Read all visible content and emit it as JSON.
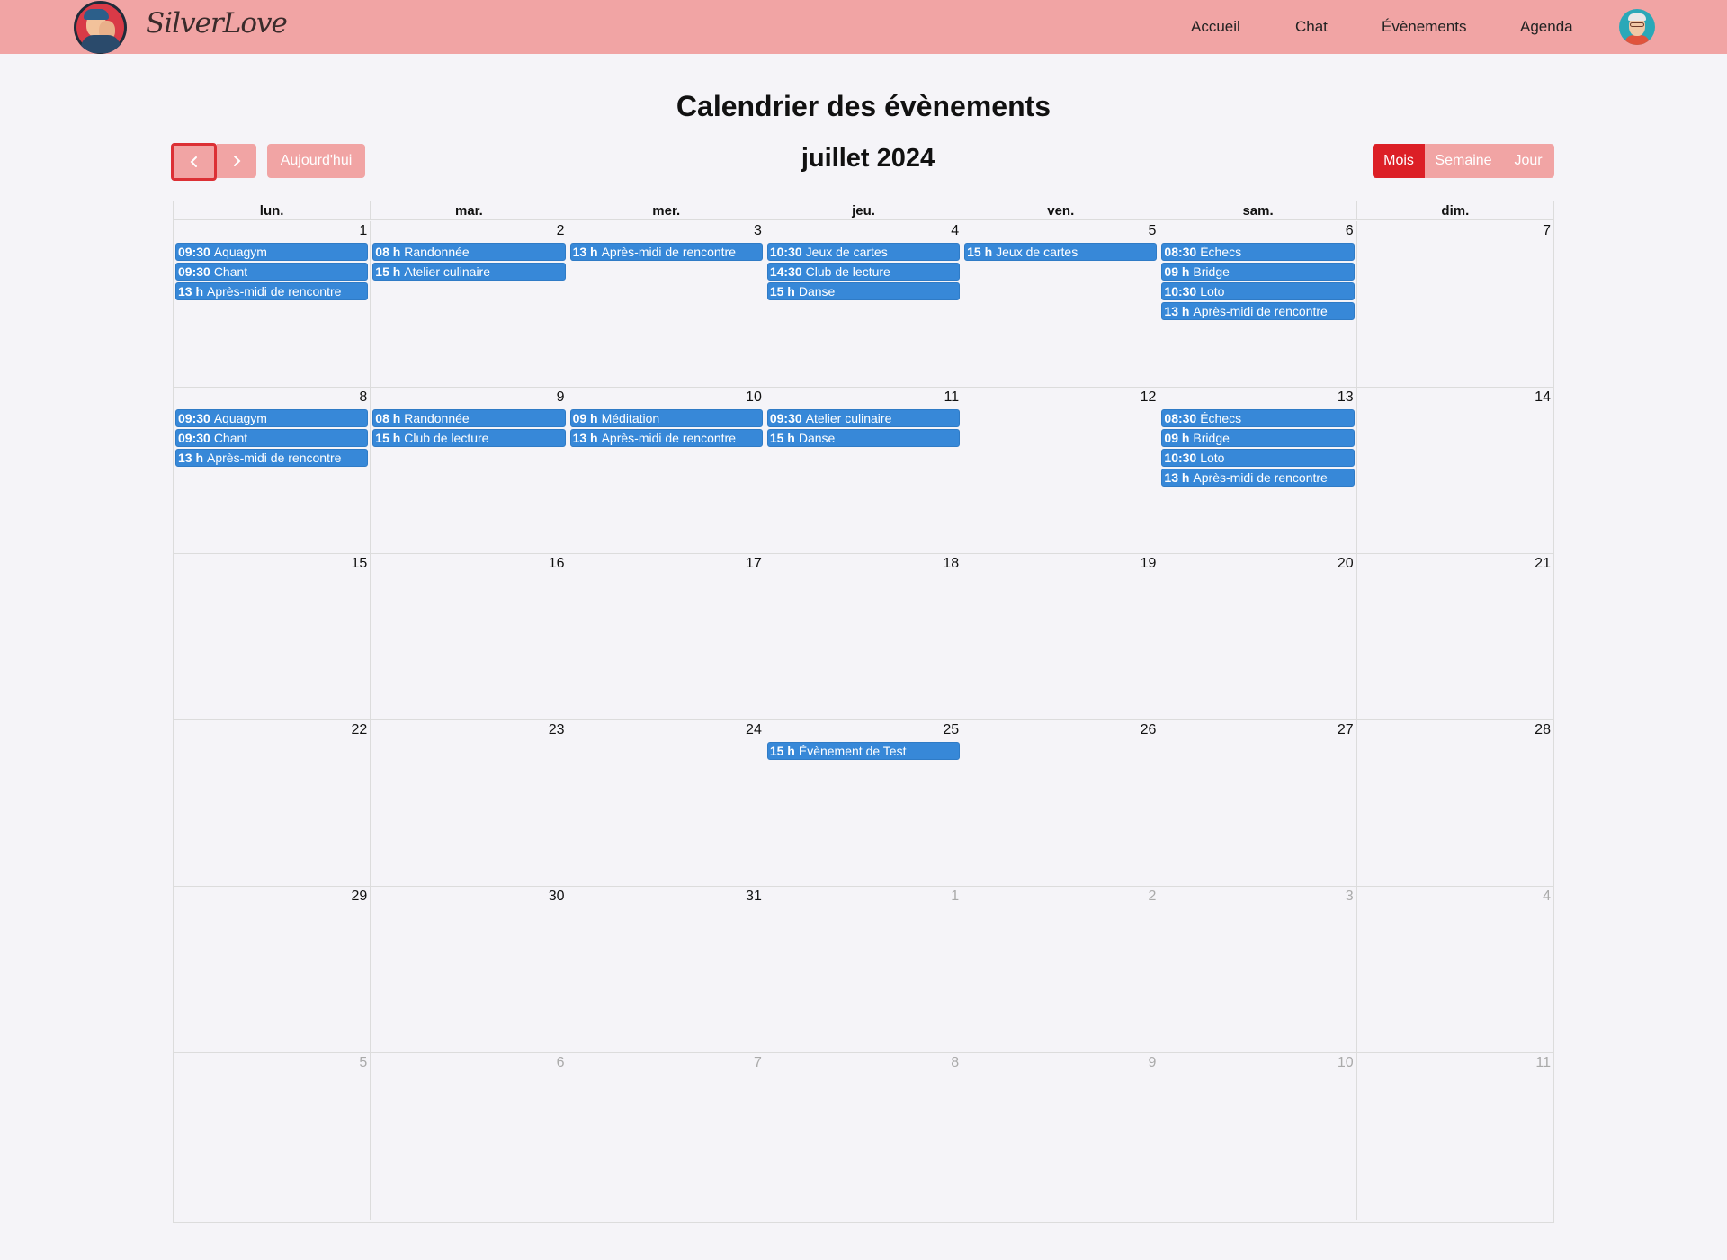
{
  "app": {
    "brand": "SilverLove",
    "nav": [
      "Accueil",
      "Chat",
      "Évènements",
      "Agenda"
    ]
  },
  "page": {
    "title": "Calendrier des évènements"
  },
  "toolbar": {
    "today_label": "Aujourd'hui",
    "title": "juillet 2024",
    "views": [
      "Mois",
      "Semaine",
      "Jour"
    ],
    "active_view": "Mois"
  },
  "colors": {
    "navbar": "#f1a4a4",
    "accent": "#dc1f26",
    "event": "#3788d8"
  },
  "calendar": {
    "weekdays": [
      "lun.",
      "mar.",
      "mer.",
      "jeu.",
      "ven.",
      "sam.",
      "dim."
    ],
    "weeks": [
      [
        {
          "day": "1",
          "events": [
            {
              "time": "09:30",
              "title": "Aquagym"
            },
            {
              "time": "09:30",
              "title": "Chant"
            },
            {
              "time": "13 h",
              "title": "Après-midi de rencontre"
            }
          ]
        },
        {
          "day": "2",
          "events": [
            {
              "time": "08 h",
              "title": "Randonnée"
            },
            {
              "time": "15 h",
              "title": "Atelier culinaire"
            }
          ]
        },
        {
          "day": "3",
          "events": [
            {
              "time": "13 h",
              "title": "Après-midi de rencontre"
            }
          ]
        },
        {
          "day": "4",
          "events": [
            {
              "time": "10:30",
              "title": "Jeux de cartes"
            },
            {
              "time": "14:30",
              "title": "Club de lecture"
            },
            {
              "time": "15 h",
              "title": "Danse"
            }
          ]
        },
        {
          "day": "5",
          "events": [
            {
              "time": "15 h",
              "title": "Jeux de cartes"
            }
          ]
        },
        {
          "day": "6",
          "events": [
            {
              "time": "08:30",
              "title": "Échecs"
            },
            {
              "time": "09 h",
              "title": "Bridge"
            },
            {
              "time": "10:30",
              "title": "Loto"
            },
            {
              "time": "13 h",
              "title": "Après-midi de rencontre"
            }
          ]
        },
        {
          "day": "7",
          "events": []
        }
      ],
      [
        {
          "day": "8",
          "events": [
            {
              "time": "09:30",
              "title": "Aquagym"
            },
            {
              "time": "09:30",
              "title": "Chant"
            },
            {
              "time": "13 h",
              "title": "Après-midi de rencontre"
            }
          ]
        },
        {
          "day": "9",
          "events": [
            {
              "time": "08 h",
              "title": "Randonnée"
            },
            {
              "time": "15 h",
              "title": "Club de lecture"
            }
          ]
        },
        {
          "day": "10",
          "events": [
            {
              "time": "09 h",
              "title": "Méditation"
            },
            {
              "time": "13 h",
              "title": "Après-midi de rencontre"
            }
          ]
        },
        {
          "day": "11",
          "events": [
            {
              "time": "09:30",
              "title": "Atelier culinaire"
            },
            {
              "time": "15 h",
              "title": "Danse"
            }
          ]
        },
        {
          "day": "12",
          "events": []
        },
        {
          "day": "13",
          "events": [
            {
              "time": "08:30",
              "title": "Échecs"
            },
            {
              "time": "09 h",
              "title": "Bridge"
            },
            {
              "time": "10:30",
              "title": "Loto"
            },
            {
              "time": "13 h",
              "title": "Après-midi de rencontre"
            }
          ]
        },
        {
          "day": "14",
          "events": []
        }
      ],
      [
        {
          "day": "15",
          "events": []
        },
        {
          "day": "16",
          "events": []
        },
        {
          "day": "17",
          "events": []
        },
        {
          "day": "18",
          "events": []
        },
        {
          "day": "19",
          "events": []
        },
        {
          "day": "20",
          "events": []
        },
        {
          "day": "21",
          "events": []
        }
      ],
      [
        {
          "day": "22",
          "events": []
        },
        {
          "day": "23",
          "events": []
        },
        {
          "day": "24",
          "events": []
        },
        {
          "day": "25",
          "events": [
            {
              "time": "15 h",
              "title": "Évènement de Test"
            }
          ]
        },
        {
          "day": "26",
          "events": []
        },
        {
          "day": "27",
          "events": []
        },
        {
          "day": "28",
          "events": []
        }
      ],
      [
        {
          "day": "29",
          "events": []
        },
        {
          "day": "30",
          "events": []
        },
        {
          "day": "31",
          "events": []
        },
        {
          "day": "1",
          "other": true,
          "events": []
        },
        {
          "day": "2",
          "other": true,
          "events": []
        },
        {
          "day": "3",
          "other": true,
          "events": []
        },
        {
          "day": "4",
          "other": true,
          "events": []
        }
      ],
      [
        {
          "day": "5",
          "other": true,
          "events": []
        },
        {
          "day": "6",
          "other": true,
          "events": []
        },
        {
          "day": "7",
          "other": true,
          "events": []
        },
        {
          "day": "8",
          "other": true,
          "events": []
        },
        {
          "day": "9",
          "other": true,
          "events": []
        },
        {
          "day": "10",
          "other": true,
          "events": []
        },
        {
          "day": "11",
          "other": true,
          "events": []
        }
      ]
    ]
  }
}
